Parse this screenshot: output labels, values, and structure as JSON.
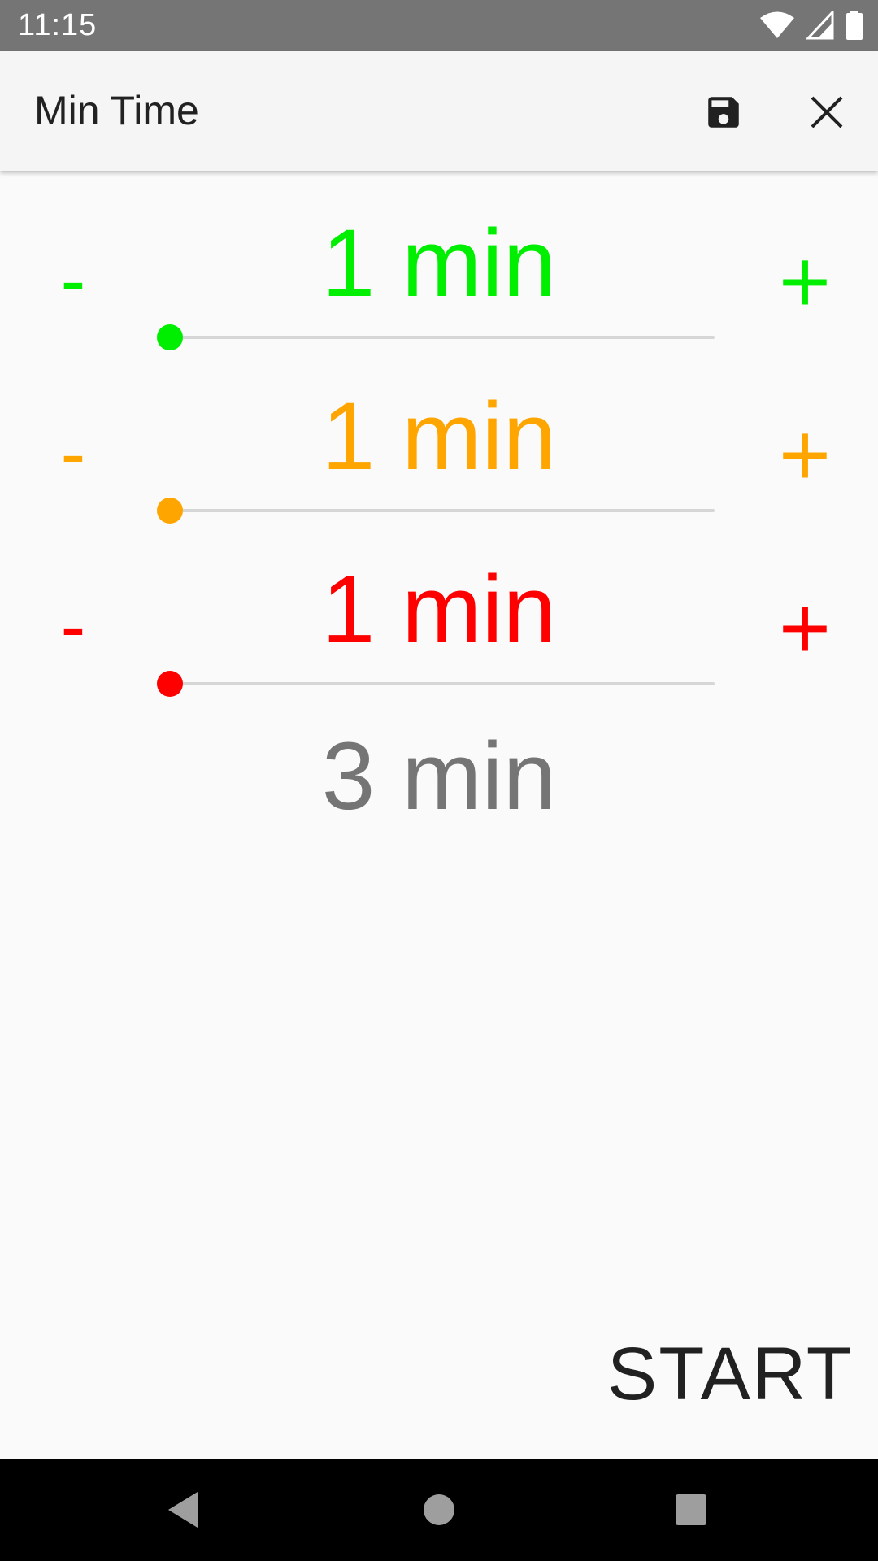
{
  "status_bar": {
    "time": "11:15",
    "icons": [
      "wifi-icon",
      "cell-signal-icon",
      "battery-icon"
    ]
  },
  "app_bar": {
    "title": "Min Time",
    "actions": [
      "save-icon",
      "close-icon"
    ]
  },
  "rows": [
    {
      "minus_label": "-",
      "plus_label": "+",
      "value_text": "1 min",
      "color": "#00ee00",
      "slider_fraction": 0
    },
    {
      "minus_label": "-",
      "plus_label": "+",
      "value_text": "1 min",
      "color": "#ffa500",
      "slider_fraction": 0
    },
    {
      "minus_label": "-",
      "plus_label": "+",
      "value_text": "1 min",
      "color": "#ff0000",
      "slider_fraction": 0
    }
  ],
  "total_text": "3 min",
  "start_label": "START",
  "nav_bar": {
    "buttons": [
      "back-icon",
      "home-icon",
      "recents-icon"
    ]
  }
}
